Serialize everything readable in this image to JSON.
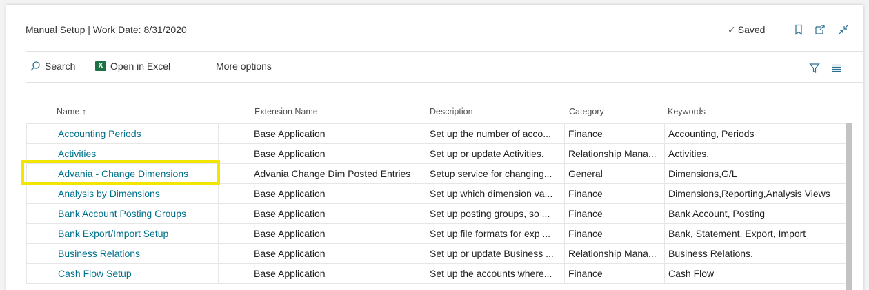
{
  "header": {
    "title": "Manual Setup | Work Date: 8/31/2020",
    "saved_label": "Saved"
  },
  "actions": {
    "search_label": "Search",
    "excel_icon_text": "X",
    "excel_label": "Open in Excel",
    "more_label": "More options"
  },
  "columns": {
    "name": "Name ↑",
    "extension": "Extension Name",
    "description": "Description",
    "category": "Category",
    "keywords": "Keywords"
  },
  "rows": [
    {
      "name": "Accounting Periods",
      "extension": "Base Application",
      "description": "Set up the number of acco...",
      "category": "Finance",
      "keywords": "Accounting, Periods"
    },
    {
      "name": "Activities",
      "extension": "Base Application",
      "description": "Set up or update Activities.",
      "category": "Relationship Mana...",
      "keywords": "Activities."
    },
    {
      "name": "Advania - Change Dimensions",
      "extension": "Advania Change Dim Posted Entries",
      "description": "Setup service for changing...",
      "category": "General",
      "keywords": "Dimensions,G/L"
    },
    {
      "name": "Analysis by Dimensions",
      "extension": "Base Application",
      "description": "Set up which dimension va...",
      "category": "Finance",
      "keywords": "Dimensions,Reporting,Analysis Views"
    },
    {
      "name": "Bank Account Posting Groups",
      "extension": "Base Application",
      "description": "Set up posting groups, so ...",
      "category": "Finance",
      "keywords": "Bank Account, Posting"
    },
    {
      "name": "Bank Export/Import Setup",
      "extension": "Base Application",
      "description": "Set up file formats for exp ...",
      "category": "Finance",
      "keywords": "Bank, Statement, Export, Import"
    },
    {
      "name": "Business Relations",
      "extension": "Base Application",
      "description": "Set up or update Business ...",
      "category": "Relationship Mana...",
      "keywords": "Business Relations."
    },
    {
      "name": "Cash Flow Setup",
      "extension": "Base Application",
      "description": "Set up the accounts where...",
      "category": "Finance",
      "keywords": "Cash Flow"
    }
  ],
  "colors": {
    "link": "#00718c",
    "highlight": "#f2e500",
    "excel": "#1e7145"
  }
}
